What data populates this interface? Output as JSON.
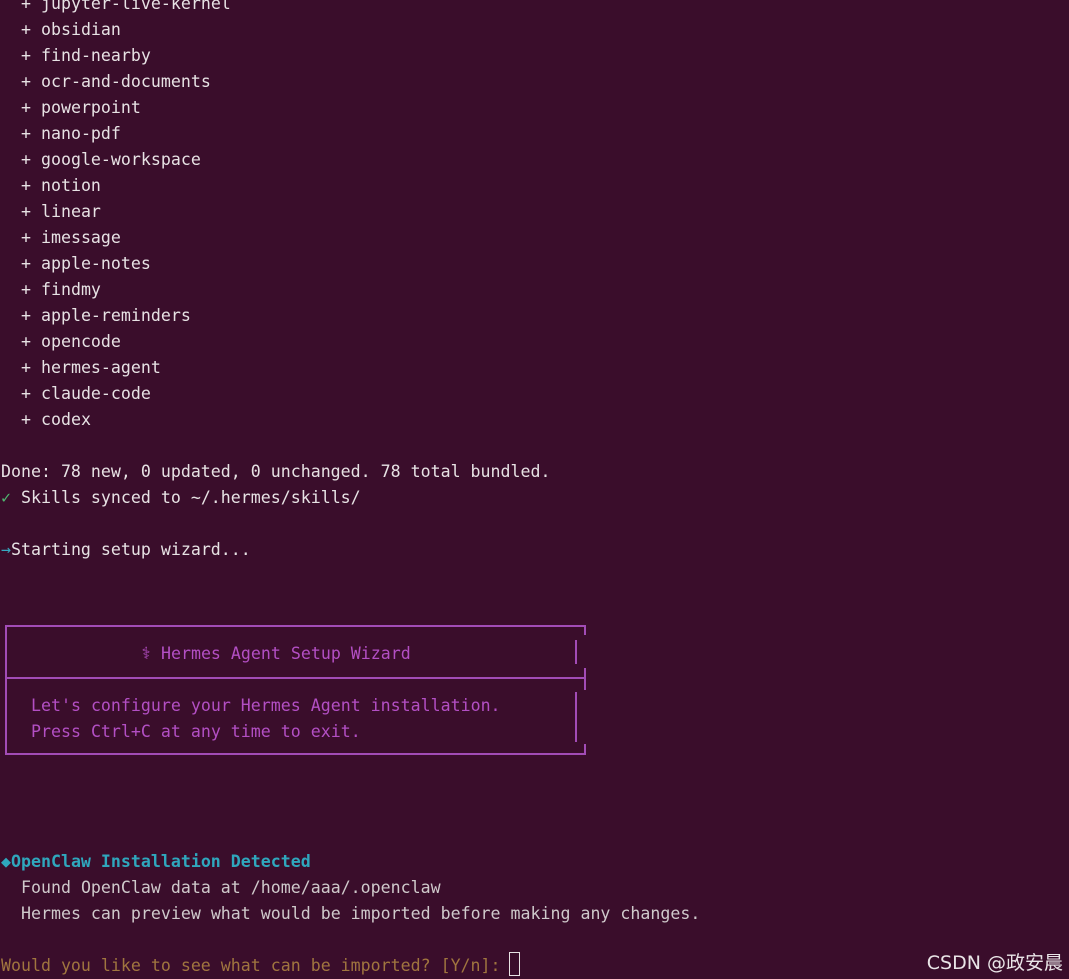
{
  "skills": {
    "prefix": "+ ",
    "items": [
      "jupyter-live-kernel",
      "obsidian",
      "find-nearby",
      "ocr-and-documents",
      "powerpoint",
      "nano-pdf",
      "google-workspace",
      "notion",
      "linear",
      "imessage",
      "apple-notes",
      "findmy",
      "apple-reminders",
      "opencode",
      "hermes-agent",
      "claude-code",
      "codex"
    ]
  },
  "summary": {
    "done": "Done: 78 new, 0 updated, 0 unchanged. 78 total bundled.",
    "check_glyph": "✓",
    "synced": " Skills synced to ~/.hermes/skills/",
    "arrow_glyph": "→",
    "starting": "Starting setup wizard..."
  },
  "wizard": {
    "title": "⚕ Hermes Agent Setup Wizard",
    "line1": "Let's configure your Hermes Agent installation.",
    "line2": "Press Ctrl+C at any time to exit."
  },
  "openclaw": {
    "diamond_glyph": "◆",
    "heading": "OpenClaw Installation Detected",
    "found": "Found OpenClaw data at /home/aaa/.openclaw",
    "preview": "Hermes can preview what would be imported before making any changes."
  },
  "prompt": {
    "question": "Would you like to see what can be imported? [Y/n]: "
  },
  "watermark": "CSDN @政安晨",
  "colors": {
    "background": "#3a0d2b",
    "text": "#e7e2e4",
    "wizard_purple": "#b34fc4",
    "heading_cyan": "#2fa7bd",
    "check_green": "#4fb56f",
    "prompt_amber": "#a0753f"
  }
}
